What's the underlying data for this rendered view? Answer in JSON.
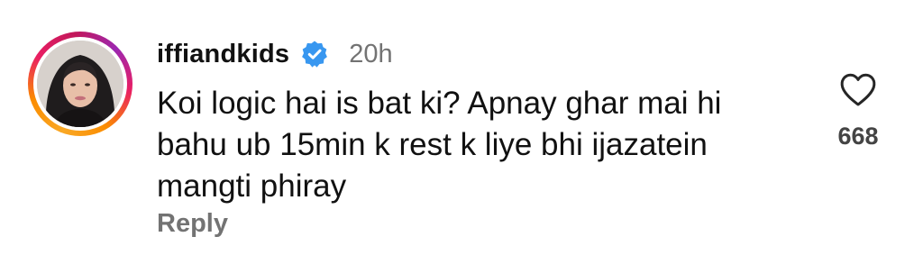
{
  "comment": {
    "username": "iffiandkids",
    "verified": true,
    "timestamp": "20h",
    "text_lines": [
      "Koi logic hai is bat ki? Apnay ghar mai hi",
      "bahu ub 15min k rest k liye bhi ijazatein",
      "mangti phiray"
    ],
    "reply_label": "Reply",
    "like_count": "668",
    "icons": {
      "like": "heart-outline-icon",
      "verified": "verified-badge-icon"
    }
  },
  "colors": {
    "verified_blue": "#3897f0",
    "meta_gray": "#737373",
    "text": "#111111"
  }
}
